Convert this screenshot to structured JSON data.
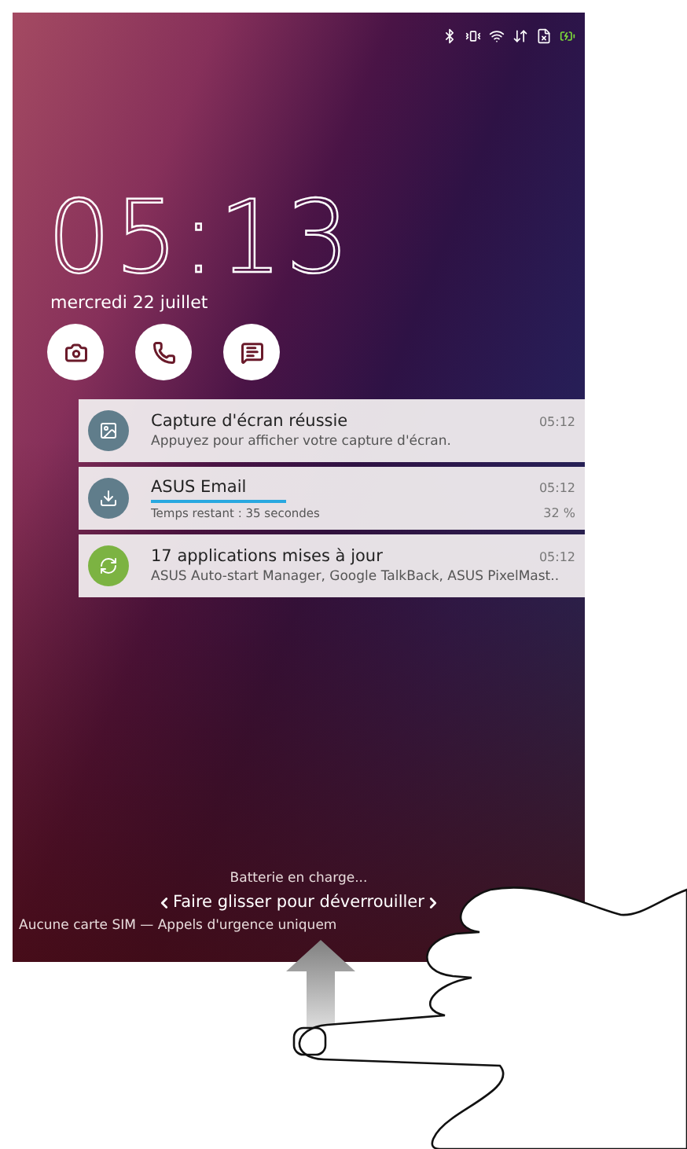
{
  "clock": {
    "time": "05:13",
    "date": "mercredi 22 juillet"
  },
  "shortcuts": [
    {
      "kind": "camera"
    },
    {
      "kind": "phone"
    },
    {
      "kind": "message"
    }
  ],
  "notifications": [
    {
      "kind": "text",
      "color": "#607d8b",
      "title": "Capture d'écran réussie",
      "time": "05:12",
      "text": "Appuyez pour afficher votre capture d'écran."
    },
    {
      "kind": "progress",
      "color": "#607d8b",
      "title": "ASUS Email",
      "time": "05:12",
      "level": 0.32,
      "text": "Temps restant : 35 secondes",
      "percent": "32 %"
    },
    {
      "kind": "text",
      "color": "#7cb342",
      "title": "17 applications mises à jour",
      "time": "05:12",
      "text": "ASUS Auto-start Manager, Google TalkBack, ASUS PixelMast.."
    }
  ],
  "footer": {
    "charging": "Batterie en charge...",
    "unlock_hint": "Faire glisser pour déverrouiller",
    "emergency": "Aucune carte SIM — Appels d'urgence uniquem"
  }
}
